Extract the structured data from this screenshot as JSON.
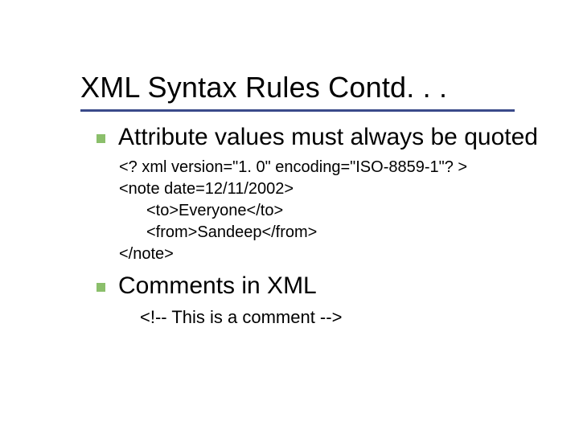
{
  "title": "XML Syntax Rules Contd. . .",
  "bullets": [
    {
      "text": "Attribute values must always be quoted",
      "code": {
        "line1": "<? xml version=\"1. 0\" encoding=\"ISO-8859-1\"? >",
        "line2": "<note date=12/11/2002>",
        "line3": "<to>Everyone</to>",
        "line4": "<from>Sandeep</from>",
        "line5": "</note>"
      }
    },
    {
      "text": "Comments in XML",
      "comment": "<!-- This is a comment -->"
    }
  ]
}
